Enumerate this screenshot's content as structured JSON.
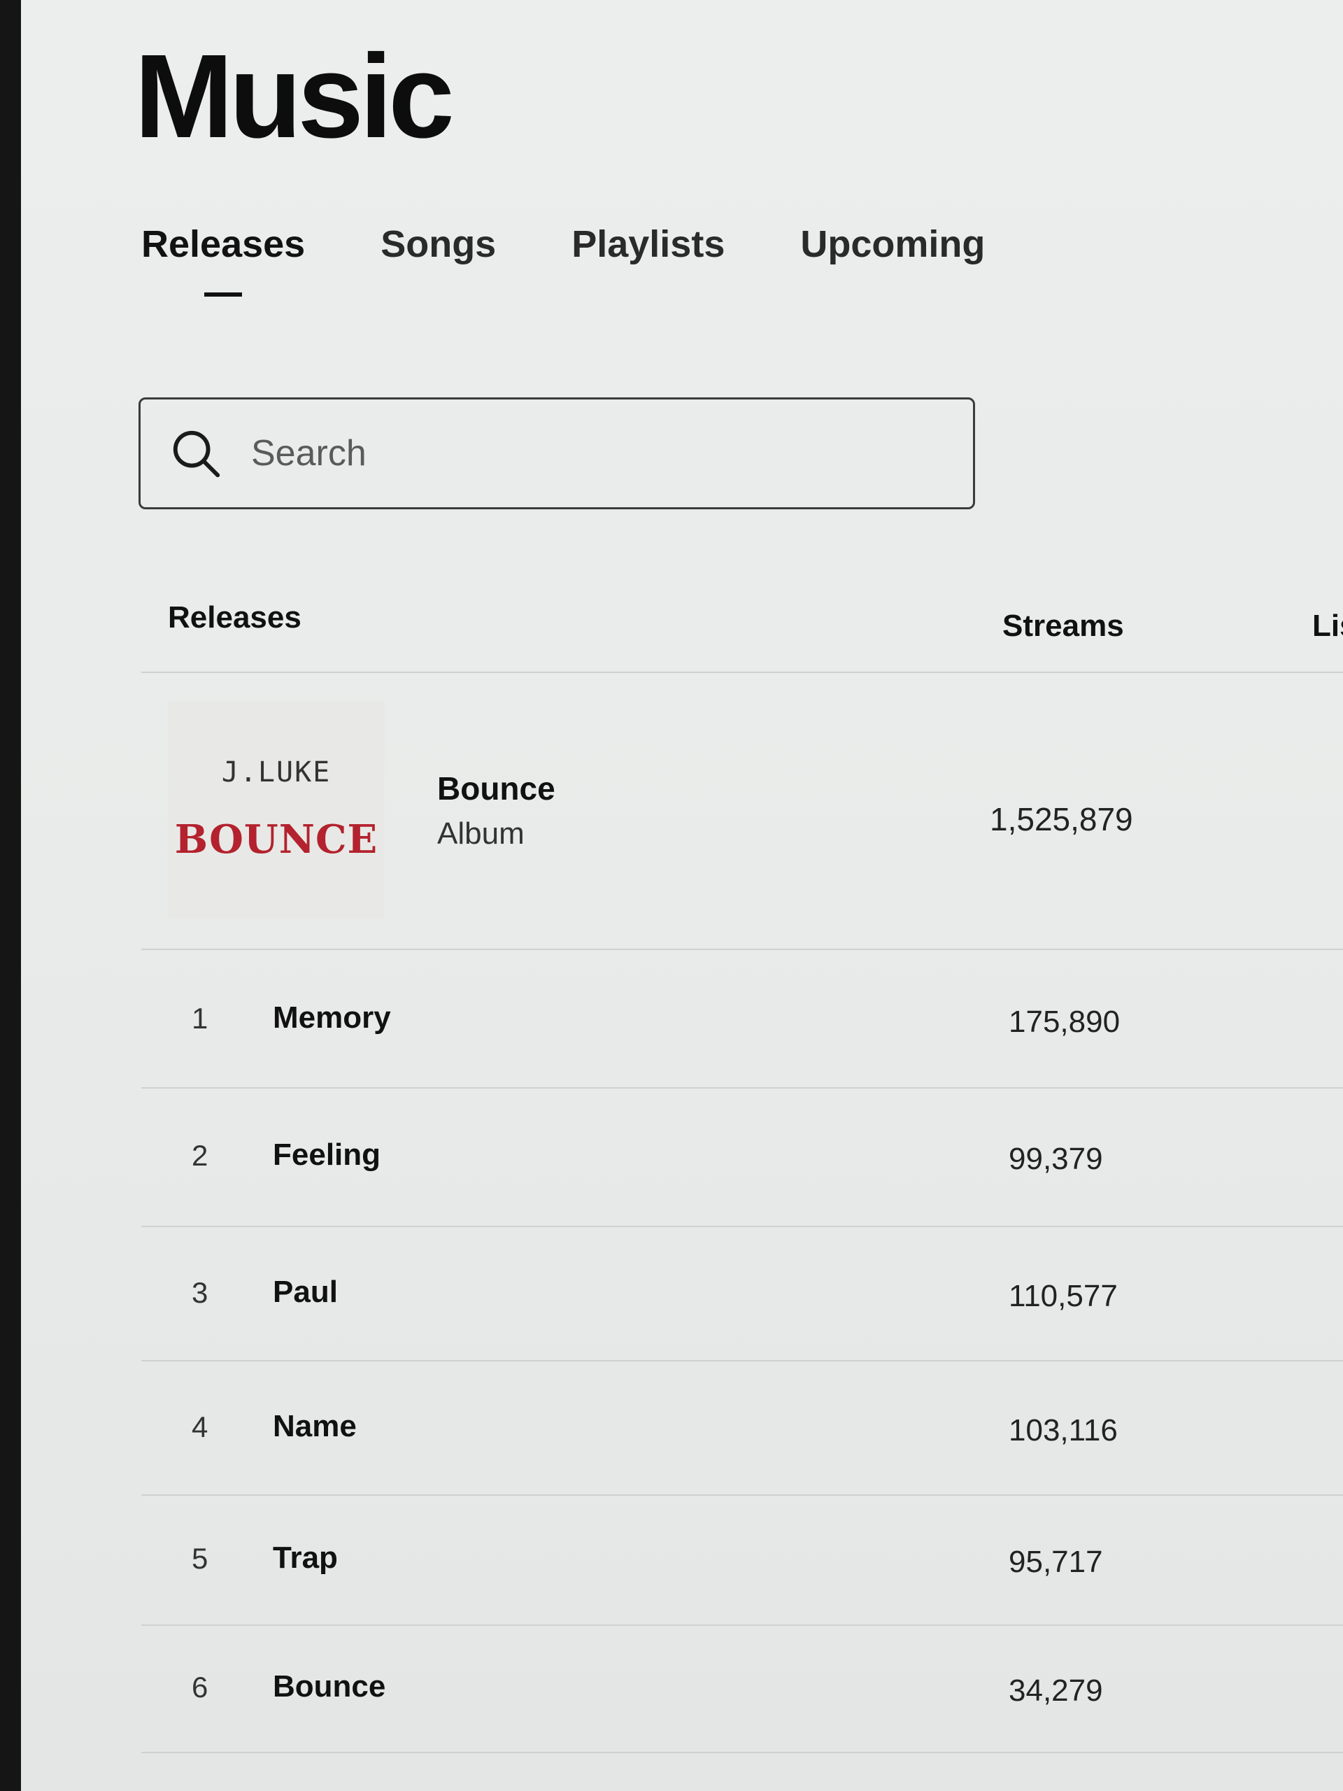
{
  "page": {
    "title": "Music"
  },
  "tabs": [
    {
      "label": "Releases",
      "active": true
    },
    {
      "label": "Songs",
      "active": false
    },
    {
      "label": "Playlists",
      "active": false
    },
    {
      "label": "Upcoming",
      "active": false
    }
  ],
  "search": {
    "placeholder": "Search",
    "icon": "search-icon"
  },
  "table": {
    "headers": {
      "releases": "Releases",
      "streams": "Streams",
      "listeners_partial": "Lis"
    },
    "album": {
      "name": "Bounce",
      "type": "Album",
      "streams": "1,525,879",
      "cover": {
        "artist_text": "J.LUKE",
        "title_text": "BOUNCE",
        "title_color": "#b3222e"
      }
    },
    "tracks": [
      {
        "num": "1",
        "name": "Memory",
        "streams": "175,890"
      },
      {
        "num": "2",
        "name": "Feeling",
        "streams": "99,379"
      },
      {
        "num": "3",
        "name": "Paul",
        "streams": "110,577"
      },
      {
        "num": "4",
        "name": "Name",
        "streams": "103,116"
      },
      {
        "num": "5",
        "name": "Trap",
        "streams": "95,717"
      },
      {
        "num": "6",
        "name": "Bounce",
        "streams": "34,279"
      }
    ]
  }
}
